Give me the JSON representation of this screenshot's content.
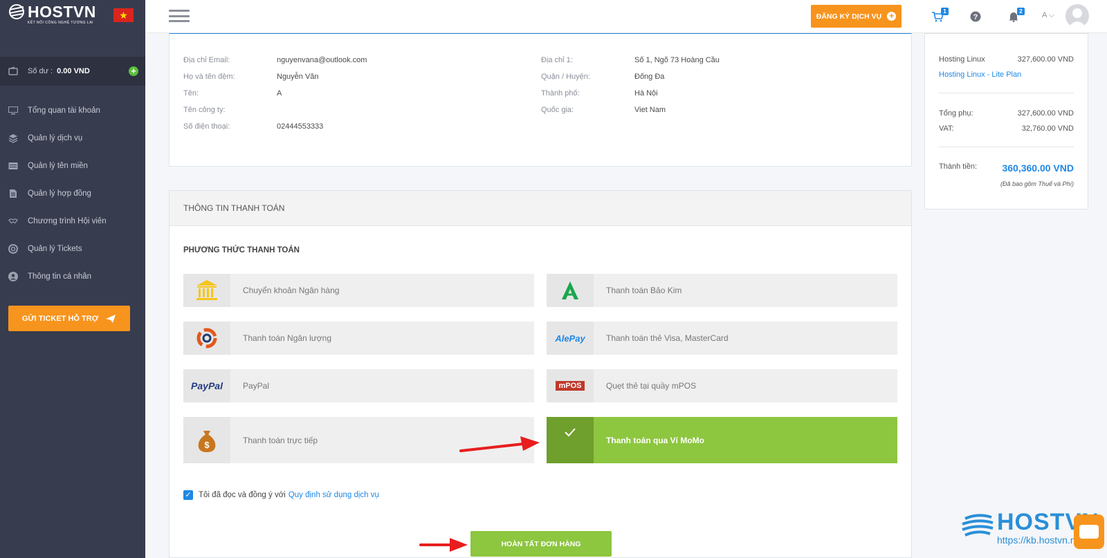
{
  "sidebar": {
    "logo_text": "HOSTVN",
    "logo_subtitle": "KẾT NỐI CÔNG NGHỆ TƯƠNG LAI",
    "balance_label": "Số dư :",
    "balance_value": "0.00 VND",
    "nav": [
      {
        "label": "Tổng quan tài khoản",
        "icon": "monitor-icon"
      },
      {
        "label": "Quản lý dịch vụ",
        "icon": "layers-icon"
      },
      {
        "label": "Quản lý tên miền",
        "icon": "domain-icon"
      },
      {
        "label": "Quản lý hợp đồng",
        "icon": "document-icon"
      },
      {
        "label": "Chương trình Hội viên",
        "icon": "handshake-icon"
      },
      {
        "label": "Quản lý Tickets",
        "icon": "lifebuoy-icon"
      },
      {
        "label": "Thông tin cá nhân",
        "icon": "user-icon"
      }
    ],
    "ticket_button": "GỬI TICKET HỖ TRỢ"
  },
  "topbar": {
    "register_button": "ĐĂNG KÝ DỊCH VỤ",
    "cart_count": "1",
    "notif_count": "2",
    "user_initial": "A"
  },
  "customer": {
    "left": [
      {
        "label": "Địa chỉ Email:",
        "value": "nguyenvana@outlook.com"
      },
      {
        "label": "Họ và tên đệm:",
        "value": "Nguyễn Văn"
      },
      {
        "label": "Tên:",
        "value": "A"
      },
      {
        "label": "Tên công ty:",
        "value": ""
      },
      {
        "label": "Số điện thoại:",
        "value": "02444553333"
      }
    ],
    "right": [
      {
        "label": "Địa chỉ 1:",
        "value": "Số 1, Ngõ 73 Hoàng Cầu"
      },
      {
        "label": "Quận / Huyện:",
        "value": "Đống Đa"
      },
      {
        "label": "Thành phố:",
        "value": "Hà Nội"
      },
      {
        "label": "Quốc gia:",
        "value": "Viet Nam"
      }
    ]
  },
  "payment": {
    "header": "THÔNG TIN THANH TOÁN",
    "subtitle": "PHƯƠNG THỨC THANH TOÁN",
    "methods": [
      {
        "label": "Chuyển khoản Ngân hàng",
        "icon": "bank-icon",
        "selected": false
      },
      {
        "label": "Thanh toán Bảo Kim",
        "icon": "baokim-logo-icon",
        "selected": false
      },
      {
        "label": "Thanh toán Ngân lượng",
        "icon": "nganluong-logo-icon",
        "selected": false
      },
      {
        "label": "Thanh toán thẻ Visa, MasterCard",
        "icon": "alepay-logo-icon",
        "selected": false
      },
      {
        "label": "PayPal",
        "icon": "paypal-logo-icon",
        "selected": false
      },
      {
        "label": "Quẹt thẻ tại quầy mPOS",
        "icon": "mpos-logo-icon",
        "selected": false
      },
      {
        "label": "Thanh toán trực tiếp",
        "icon": "money-bag-icon",
        "selected": false
      },
      {
        "label": "Thanh toán qua Ví MoMo",
        "icon": "check-icon",
        "selected": true
      }
    ],
    "alepay_text": "AlePay",
    "paypal_text": "PayPal",
    "mpos_text": "mPOS",
    "agree_text": "Tôi đã đọc và đồng ý với",
    "agree_link": "Quy định sử dụng dịch vụ",
    "agree_checked": true,
    "finish_button": "HOÀN TẤT ĐƠN HÀNG"
  },
  "summary": {
    "item_name": "Hosting Linux",
    "item_price": "327,600.00 VND",
    "item_plan": "Hosting Linux - Lite Plan",
    "subtotal_label": "Tổng phụ:",
    "subtotal_value": "327,600.00 VND",
    "vat_label": "VAT:",
    "vat_value": "32,760.00 VND",
    "total_label": "Thành tiền:",
    "total_value": "360,360.00 VND",
    "total_note": "(Đã bao gồm Thuế và Phí)"
  },
  "watermark": {
    "text": "HOSTVN",
    "url": "https://kb.hostvn.net"
  },
  "colors": {
    "accent_orange": "#f7941d",
    "accent_green": "#8dc63f",
    "link_blue": "#1e88e5",
    "sidebar_bg": "#383c4f"
  }
}
